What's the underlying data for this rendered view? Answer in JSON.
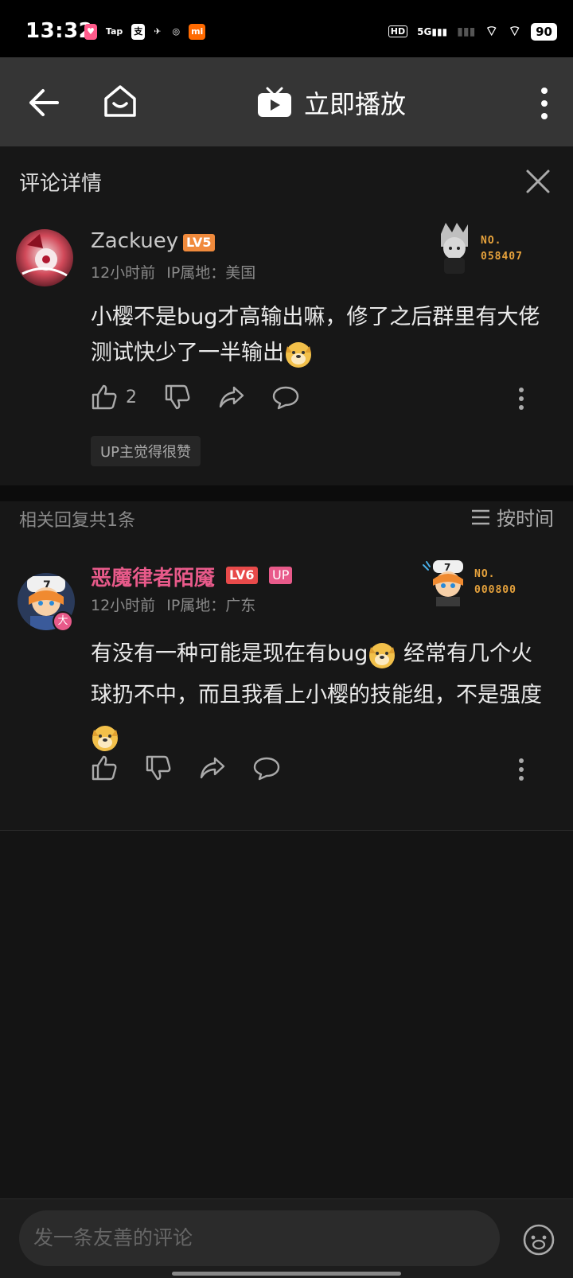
{
  "status_bar": {
    "time": "13:32",
    "battery": "90",
    "network": "5G",
    "hd": "HD",
    "app_icons": [
      "Tap",
      "mi"
    ]
  },
  "top_bar": {
    "title": "立即播放"
  },
  "comment_detail": {
    "title": "评论详情",
    "comment": {
      "username": "Zackuey",
      "level": "LV5",
      "time": "12小时前",
      "ip": "IP属地：美国",
      "text_part1": "小樱不是bug才高输出嘛，修了之后群里有大佬测试快少了一半输出",
      "likes": "2",
      "up_liked_tag": "UP主觉得很赞",
      "fan_no_label": "NO.",
      "fan_no": "058407"
    }
  },
  "replies": {
    "header": "相关回复共1条",
    "sort_label": "按时间",
    "items": [
      {
        "username": "恶魔律者陌魇",
        "level": "LV6",
        "up_tag": "UP",
        "time": "12小时前",
        "ip": "IP属地：广东",
        "text_a": "有没有一种可能是现在有bug",
        "text_b": "经常有几个火球扔不中，而且我看上小樱的技能组，不是强度",
        "fan_no_label": "NO.",
        "fan_no": "000800",
        "avatar_badge": "大"
      }
    ]
  },
  "bottom": {
    "placeholder": "发一条友善的评论"
  },
  "colors": {
    "accent_pink": "#e85a8a",
    "level5": "#f08a3c",
    "level6": "#e84a4a",
    "fan_gold": "#e6a23c"
  }
}
